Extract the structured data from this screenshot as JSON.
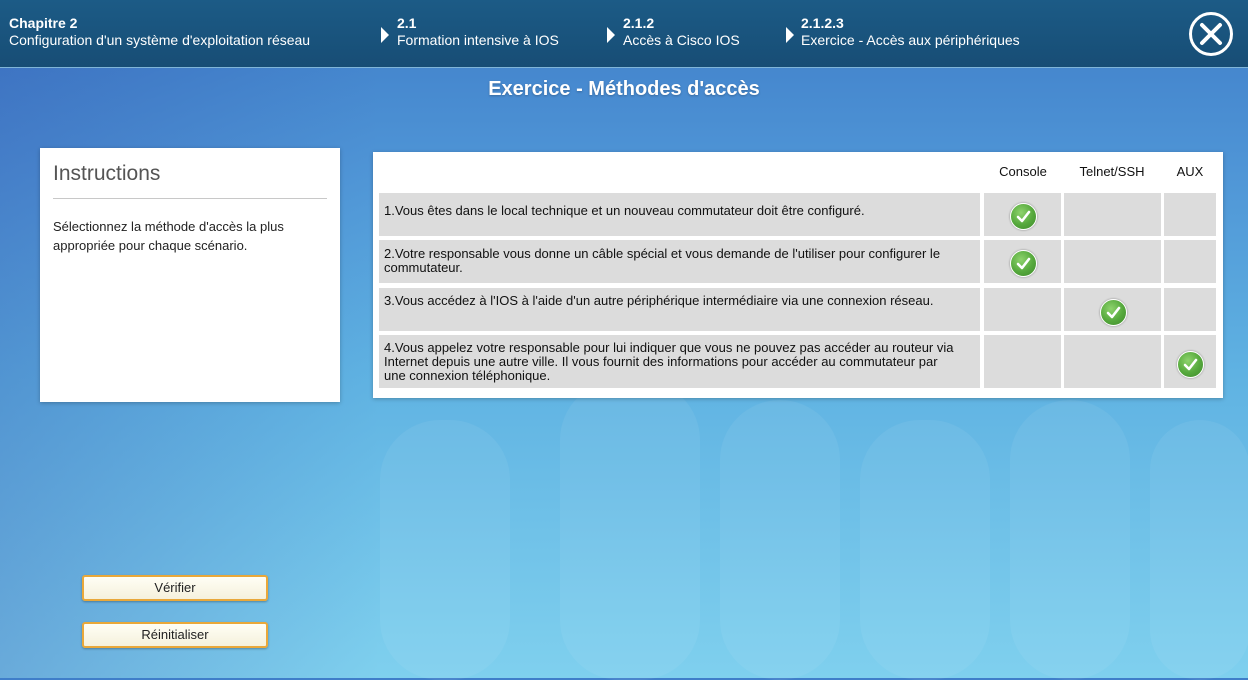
{
  "header": {
    "crumbs": [
      {
        "num": "Chapitre 2",
        "label": "Configuration d'un système d'exploitation réseau"
      },
      {
        "num": "2.1",
        "label": "Formation intensive à IOS"
      },
      {
        "num": "2.1.2",
        "label": "Accès à Cisco IOS"
      },
      {
        "num": "2.1.2.3",
        "label": "Exercice - Accès aux périphériques"
      }
    ],
    "close_icon": "close-x-icon"
  },
  "title": "Exercice - Méthodes d'accès",
  "instructions": {
    "heading": "Instructions",
    "text": "Sélectionnez la méthode d'accès la plus appropriée pour chaque scénario."
  },
  "table": {
    "columns": [
      "Console",
      "Telnet/SSH",
      "AUX"
    ],
    "rows": [
      {
        "question": "1.Vous êtes dans le local technique et un nouveau commutateur doit être configuré.",
        "answer": "Console"
      },
      {
        "question": "2.Votre responsable vous donne un câble spécial et vous demande de l'utiliser pour configurer le commutateur.",
        "answer": "Console"
      },
      {
        "question": "3.Vous accédez à l'IOS à l'aide d'un autre périphérique intermédiaire via une connexion réseau.",
        "answer": "Telnet/SSH"
      },
      {
        "question": "4.Vous appelez votre responsable pour lui indiquer que vous ne pouvez pas accéder au routeur via Internet depuis une autre ville. Il vous fournit des informations pour accéder au commutateur par une connexion téléphonique.",
        "answer": "AUX"
      }
    ],
    "check_icon": "green-check-icon"
  },
  "buttons": {
    "verify": "Vérifier",
    "reset": "Réinitialiser"
  }
}
